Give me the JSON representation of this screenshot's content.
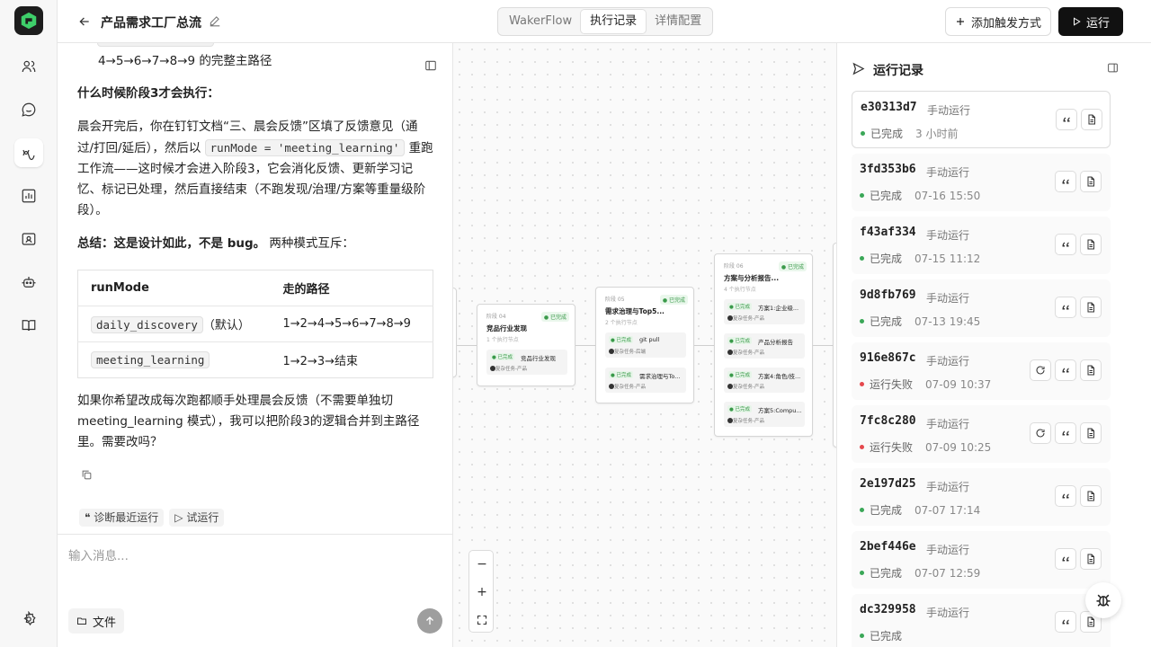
{
  "header": {
    "title": "产品需求工厂总流",
    "tabs": [
      {
        "label": "WakerFlow",
        "active": false
      },
      {
        "label": "执行记录",
        "active": true
      },
      {
        "label": "详情配置",
        "active": false
      }
    ],
    "add_trigger_label": "添加触发方式",
    "run_label": "运行"
  },
  "chat": {
    "path_line": "4→5→6→7→8→9 的完整主路径",
    "q_heading": "什么时候阶段3才会执行：",
    "p1_a": "晨会开完后，你在钉钉文档“三、晨会反馈”区填了反馈意见（通过/打回/延后），然后以 ",
    "p1_code": "runMode = 'meeting_learning'",
    "p1_b": " 重跑工作流——这时候才会进入阶段3，它会消化反馈、更新学习记忆、标记已处理，然后直接结束（不跑发现/治理/方案等重量级阶段）。",
    "summary_bold": "总结：这是设计如此，不是 bug。",
    "summary_rest": " 两种模式互斥：",
    "table": {
      "headers": [
        "runMode",
        "走的路径"
      ],
      "rows": [
        {
          "mode": "daily_discovery",
          "note": "（默认）",
          "path": "1→2→4→5→6→7→8→9"
        },
        {
          "mode": "meeting_learning",
          "note": "",
          "path": "1→2→3→结束"
        }
      ]
    },
    "closing": "如果你希望改成每次跑都顺手处理晨会反馈（不需要单独切 meeting_learning 模式），我可以把阶段3的逻辑合并到主路径里。需要改吗？",
    "chips": [
      "诊断最近运行",
      "试运行"
    ],
    "input_placeholder": "输入消息...",
    "file_label": "文件"
  },
  "canvas": {
    "nodes": [
      {
        "stage": "阶段 04",
        "title": "竞品行业发现",
        "sub": "1 个执行节点",
        "badge": "● 已完成",
        "tasks": [
          {
            "status": "● 已完成",
            "name": "竞品行业发现",
            "agent": "复杂任务-产品"
          }
        ]
      },
      {
        "stage": "阶段 05",
        "title": "需求治理与Top5...",
        "sub": "2 个执行节点",
        "badge": "● 已完成",
        "tasks": [
          {
            "status": "● 已完成",
            "name": "git pull",
            "agent": "复杂任务-后端"
          },
          {
            "status": "● 已完成",
            "name": "需求治理与To...",
            "agent": "复杂任务-产品"
          }
        ]
      },
      {
        "stage": "阶段 06",
        "title": "方案与分析报告...",
        "sub": "4 个执行节点",
        "badge": "● 已完成",
        "tasks": [
          {
            "status": "● 已完成",
            "name": "方案1:企业级...",
            "agent": "复杂任务-产品"
          },
          {
            "status": "● 已完成",
            "name": "产品分析报告",
            "agent": "复杂任务-产品"
          },
          {
            "status": "● 已完成",
            "name": "方案4:角色/技...",
            "agent": "复杂任务-产品"
          },
          {
            "status": "● 已完成",
            "name": "方案5:Compu...",
            "agent": "复杂任务-产品"
          }
        ]
      }
    ],
    "zoom_out": "−",
    "zoom_in": "+"
  },
  "runs": {
    "title": "运行记录",
    "success_color": "#3aa757",
    "fail_color": "#e5484d",
    "items": [
      {
        "id": "e30313d7",
        "mode": "手动运行",
        "status": "已完成",
        "time": "3 小时前",
        "ok": true,
        "retry": false
      },
      {
        "id": "3fd353b6",
        "mode": "手动运行",
        "status": "已完成",
        "time": "07-16 15:50",
        "ok": true,
        "retry": false
      },
      {
        "id": "f43af334",
        "mode": "手动运行",
        "status": "已完成",
        "time": "07-15 11:12",
        "ok": true,
        "retry": false
      },
      {
        "id": "9d8fb769",
        "mode": "手动运行",
        "status": "已完成",
        "time": "07-13 19:45",
        "ok": true,
        "retry": false
      },
      {
        "id": "916e867c",
        "mode": "手动运行",
        "status": "运行失败",
        "time": "07-09 10:37",
        "ok": false,
        "retry": true
      },
      {
        "id": "7fc8c280",
        "mode": "手动运行",
        "status": "运行失败",
        "time": "07-09 10:25",
        "ok": false,
        "retry": true
      },
      {
        "id": "2e197d25",
        "mode": "手动运行",
        "status": "已完成",
        "time": "07-07 17:14",
        "ok": true,
        "retry": false
      },
      {
        "id": "2bef446e",
        "mode": "手动运行",
        "status": "已完成",
        "time": "07-07 12:59",
        "ok": true,
        "retry": false
      },
      {
        "id": "dc329958",
        "mode": "手动运行",
        "status": "已完成",
        "time": "",
        "ok": true,
        "retry": false
      }
    ]
  }
}
